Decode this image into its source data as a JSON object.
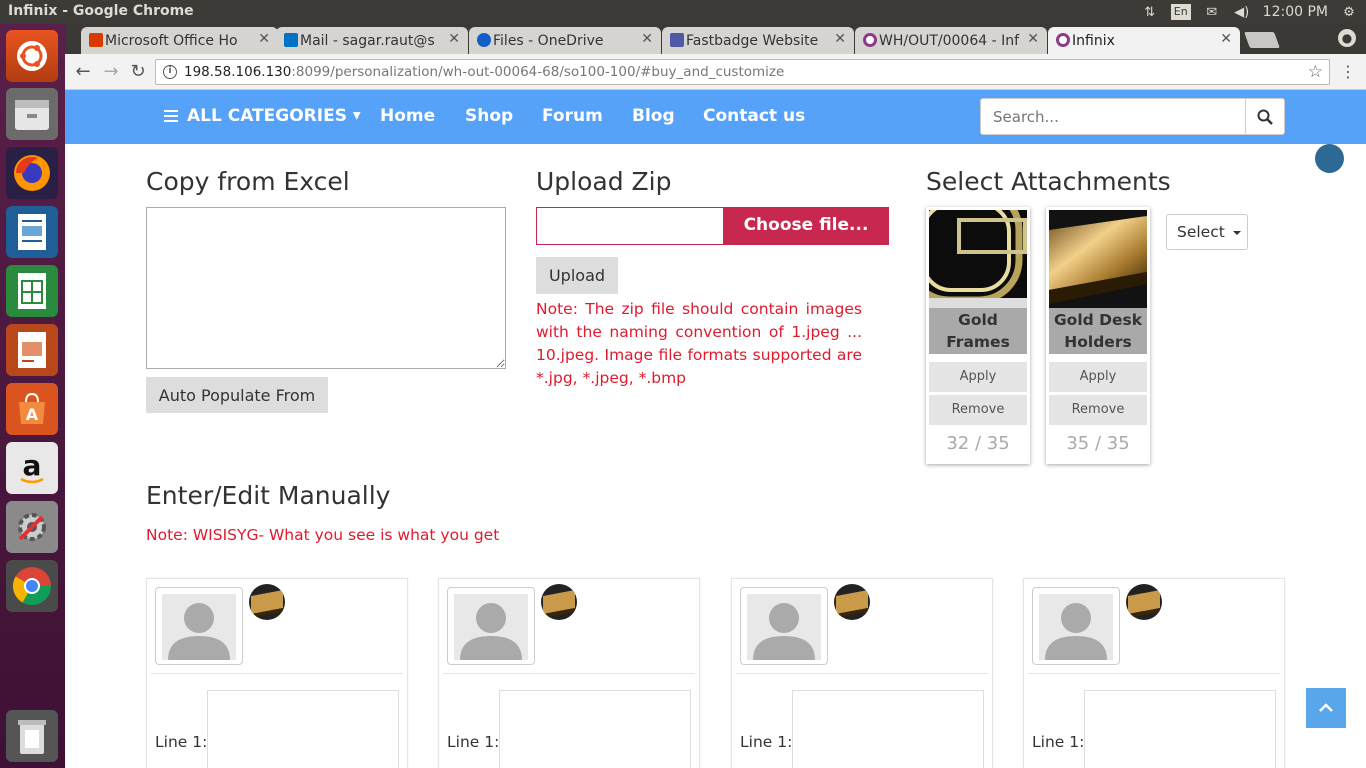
{
  "os": {
    "window_title": "Infinix - Google Chrome",
    "keyboard_layout": "En",
    "clock": "12:00 PM"
  },
  "launcher": {
    "items": [
      "ubuntu-dash",
      "files",
      "firefox",
      "writer",
      "calc",
      "impress",
      "software-center",
      "amazon",
      "system-settings",
      "chrome",
      "trash"
    ]
  },
  "browser": {
    "tabs": [
      {
        "title": "Microsoft Office Ho",
        "favicon_color": "#d83b01"
      },
      {
        "title": "Mail - sagar.raut@s",
        "favicon_color": "#0072c6"
      },
      {
        "title": "Files - OneDrive",
        "favicon_color": "#0f5fc7"
      },
      {
        "title": "Fastbadge Website",
        "favicon_color": "#5058a6"
      },
      {
        "title": "WH/OUT/00064 - Inf",
        "favicon_color": "#8e3a8c"
      },
      {
        "title": "Infinix",
        "favicon_color": "#8e3a8c"
      }
    ],
    "url_host": "198.58.106.130",
    "url_rest": ":8099/personalization/wh-out-00064-68/so100-100/#buy_and_customize"
  },
  "site": {
    "nav": {
      "categories": "ALL CATEGORIES",
      "home": "Home",
      "shop": "Shop",
      "forum": "Forum",
      "blog": "Blog",
      "contact": "Contact us"
    },
    "search_placeholder": "Search..."
  },
  "sections": {
    "excel_title": "Copy from Excel",
    "auto_populate": "Auto Populate From",
    "zip_title": "Upload Zip",
    "choose_file": "Choose file...",
    "upload": "Upload",
    "zip_note": "Note: The zip file should contain images with the naming convention of 1.jpeg ... 10.jpeg. Image file formats supported are *.jpg, *.jpeg, *.bmp",
    "attachments_title": "Select Attachments",
    "select_label": "Select",
    "manual_title": "Enter/Edit Manually",
    "wysiwyg_note": "Note: WISISYG- What you see is what you get"
  },
  "attachments": [
    {
      "name": "Gold Frames",
      "apply": "Apply",
      "remove": "Remove",
      "used": "32",
      "sep": "/",
      "total": "35"
    },
    {
      "name": "Gold Desk Holders",
      "apply": "Apply",
      "remove": "Remove",
      "used": "35",
      "sep": "/",
      "total": "35"
    }
  ],
  "cards": [
    {
      "line_label": "Line 1:"
    },
    {
      "line_label": "Line 1:"
    },
    {
      "line_label": "Line 1:"
    },
    {
      "line_label": "Line 1:"
    }
  ],
  "colors": {
    "nav_blue": "#55a2f8",
    "accent_red": "#c8284f",
    "note_red": "#e01b2e"
  }
}
